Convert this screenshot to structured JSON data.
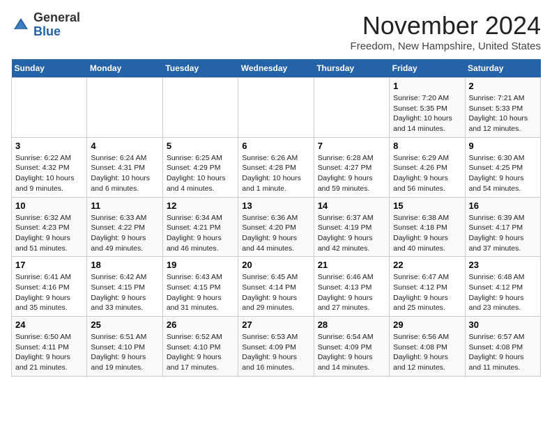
{
  "header": {
    "logo_general": "General",
    "logo_blue": "Blue",
    "month_title": "November 2024",
    "location": "Freedom, New Hampshire, United States"
  },
  "weekdays": [
    "Sunday",
    "Monday",
    "Tuesday",
    "Wednesday",
    "Thursday",
    "Friday",
    "Saturday"
  ],
  "weeks": [
    [
      {
        "day": "",
        "info": ""
      },
      {
        "day": "",
        "info": ""
      },
      {
        "day": "",
        "info": ""
      },
      {
        "day": "",
        "info": ""
      },
      {
        "day": "",
        "info": ""
      },
      {
        "day": "1",
        "info": "Sunrise: 7:20 AM\nSunset: 5:35 PM\nDaylight: 10 hours and 14 minutes."
      },
      {
        "day": "2",
        "info": "Sunrise: 7:21 AM\nSunset: 5:33 PM\nDaylight: 10 hours and 12 minutes."
      }
    ],
    [
      {
        "day": "3",
        "info": "Sunrise: 6:22 AM\nSunset: 4:32 PM\nDaylight: 10 hours and 9 minutes."
      },
      {
        "day": "4",
        "info": "Sunrise: 6:24 AM\nSunset: 4:31 PM\nDaylight: 10 hours and 6 minutes."
      },
      {
        "day": "5",
        "info": "Sunrise: 6:25 AM\nSunset: 4:29 PM\nDaylight: 10 hours and 4 minutes."
      },
      {
        "day": "6",
        "info": "Sunrise: 6:26 AM\nSunset: 4:28 PM\nDaylight: 10 hours and 1 minute."
      },
      {
        "day": "7",
        "info": "Sunrise: 6:28 AM\nSunset: 4:27 PM\nDaylight: 9 hours and 59 minutes."
      },
      {
        "day": "8",
        "info": "Sunrise: 6:29 AM\nSunset: 4:26 PM\nDaylight: 9 hours and 56 minutes."
      },
      {
        "day": "9",
        "info": "Sunrise: 6:30 AM\nSunset: 4:25 PM\nDaylight: 9 hours and 54 minutes."
      }
    ],
    [
      {
        "day": "10",
        "info": "Sunrise: 6:32 AM\nSunset: 4:23 PM\nDaylight: 9 hours and 51 minutes."
      },
      {
        "day": "11",
        "info": "Sunrise: 6:33 AM\nSunset: 4:22 PM\nDaylight: 9 hours and 49 minutes."
      },
      {
        "day": "12",
        "info": "Sunrise: 6:34 AM\nSunset: 4:21 PM\nDaylight: 9 hours and 46 minutes."
      },
      {
        "day": "13",
        "info": "Sunrise: 6:36 AM\nSunset: 4:20 PM\nDaylight: 9 hours and 44 minutes."
      },
      {
        "day": "14",
        "info": "Sunrise: 6:37 AM\nSunset: 4:19 PM\nDaylight: 9 hours and 42 minutes."
      },
      {
        "day": "15",
        "info": "Sunrise: 6:38 AM\nSunset: 4:18 PM\nDaylight: 9 hours and 40 minutes."
      },
      {
        "day": "16",
        "info": "Sunrise: 6:39 AM\nSunset: 4:17 PM\nDaylight: 9 hours and 37 minutes."
      }
    ],
    [
      {
        "day": "17",
        "info": "Sunrise: 6:41 AM\nSunset: 4:16 PM\nDaylight: 9 hours and 35 minutes."
      },
      {
        "day": "18",
        "info": "Sunrise: 6:42 AM\nSunset: 4:15 PM\nDaylight: 9 hours and 33 minutes."
      },
      {
        "day": "19",
        "info": "Sunrise: 6:43 AM\nSunset: 4:15 PM\nDaylight: 9 hours and 31 minutes."
      },
      {
        "day": "20",
        "info": "Sunrise: 6:45 AM\nSunset: 4:14 PM\nDaylight: 9 hours and 29 minutes."
      },
      {
        "day": "21",
        "info": "Sunrise: 6:46 AM\nSunset: 4:13 PM\nDaylight: 9 hours and 27 minutes."
      },
      {
        "day": "22",
        "info": "Sunrise: 6:47 AM\nSunset: 4:12 PM\nDaylight: 9 hours and 25 minutes."
      },
      {
        "day": "23",
        "info": "Sunrise: 6:48 AM\nSunset: 4:12 PM\nDaylight: 9 hours and 23 minutes."
      }
    ],
    [
      {
        "day": "24",
        "info": "Sunrise: 6:50 AM\nSunset: 4:11 PM\nDaylight: 9 hours and 21 minutes."
      },
      {
        "day": "25",
        "info": "Sunrise: 6:51 AM\nSunset: 4:10 PM\nDaylight: 9 hours and 19 minutes."
      },
      {
        "day": "26",
        "info": "Sunrise: 6:52 AM\nSunset: 4:10 PM\nDaylight: 9 hours and 17 minutes."
      },
      {
        "day": "27",
        "info": "Sunrise: 6:53 AM\nSunset: 4:09 PM\nDaylight: 9 hours and 16 minutes."
      },
      {
        "day": "28",
        "info": "Sunrise: 6:54 AM\nSunset: 4:09 PM\nDaylight: 9 hours and 14 minutes."
      },
      {
        "day": "29",
        "info": "Sunrise: 6:56 AM\nSunset: 4:08 PM\nDaylight: 9 hours and 12 minutes."
      },
      {
        "day": "30",
        "info": "Sunrise: 6:57 AM\nSunset: 4:08 PM\nDaylight: 9 hours and 11 minutes."
      }
    ]
  ]
}
